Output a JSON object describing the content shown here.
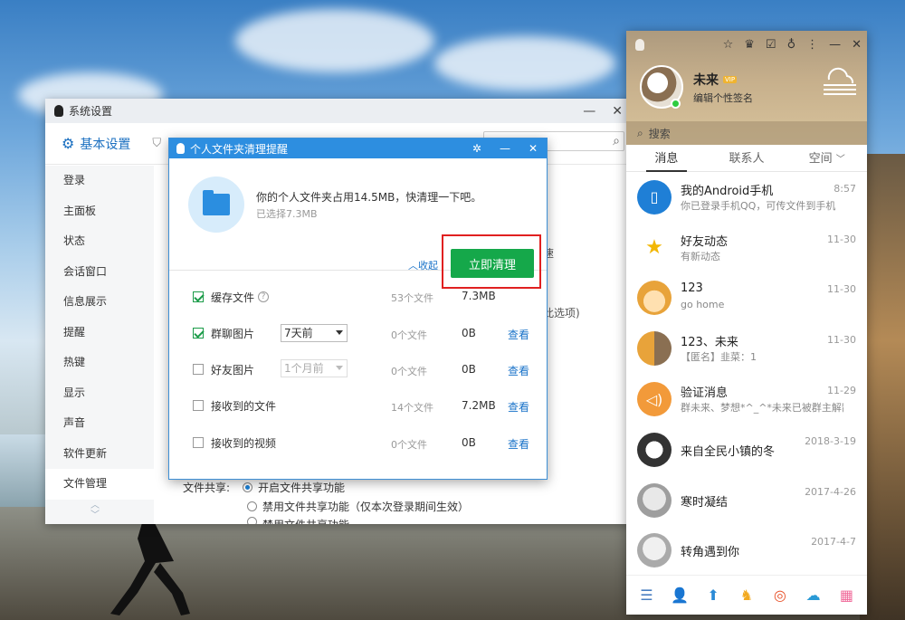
{
  "settings_window": {
    "title": "系统设置",
    "tab_basic": "基本设置",
    "sidebar": [
      {
        "label": "登录"
      },
      {
        "label": "主面板"
      },
      {
        "label": "状态"
      },
      {
        "label": "会话窗口"
      },
      {
        "label": "信息展示"
      },
      {
        "label": "提醒"
      },
      {
        "label": "热键"
      },
      {
        "label": "显示"
      },
      {
        "label": "声音"
      },
      {
        "label": "软件更新"
      },
      {
        "label": "文件管理"
      }
    ],
    "file_share_label": "文件共享:",
    "share_options": [
      "开启文件共享功能",
      "禁用文件共享功能（仅本次登录期间生效）",
      "禁用文件共享功能"
    ],
    "bg_fragment_1": "速",
    "bg_fragment_2": "此选项)"
  },
  "cleanup_popup": {
    "title": "个人文件夹清理提醒",
    "message": "你的个人文件夹占用14.5MB，快清理一下吧。",
    "selected": "已选择7.3MB",
    "collapse": "收起",
    "clean_button": "立即清理",
    "rows": [
      {
        "label": "缓存文件",
        "checked": true,
        "count": "53个文件",
        "size": "7.3MB",
        "view": ""
      },
      {
        "label": "群聊图片",
        "checked": true,
        "dropdown": "7天前",
        "count": "0个文件",
        "size": "0B",
        "view": "查看"
      },
      {
        "label": "好友图片",
        "checked": false,
        "dropdown": "1个月前",
        "count": "0个文件",
        "size": "0B",
        "view": "查看"
      },
      {
        "label": "接收到的文件",
        "checked": false,
        "count": "14个文件",
        "size": "7.2MB",
        "view": "查看"
      },
      {
        "label": "接收到的视频",
        "checked": false,
        "count": "0个文件",
        "size": "0B",
        "view": "查看"
      }
    ]
  },
  "qq_panel": {
    "nickname": "未来",
    "badge": "VIP",
    "signature": "编辑个性签名",
    "search_placeholder": "搜索",
    "tabs": [
      "消息",
      "联系人",
      "空间"
    ],
    "conversations": [
      {
        "name": "我的Android手机",
        "preview": "你已登录手机QQ，可传文件到手机",
        "time": "8:57",
        "avatar_color": "#1f7fd6",
        "icon": "phone-icon"
      },
      {
        "name": "好友动态",
        "preview": "有新动态",
        "time": "11-30",
        "avatar_color": "#ffffff",
        "icon": "qzone-star-icon"
      },
      {
        "name": "123",
        "preview": "go home",
        "time": "11-30",
        "avatar_color": "#f0c27a",
        "icon": "cartoon-avatar"
      },
      {
        "name": "123、未来",
        "preview": "【匿名】韭菜：1",
        "time": "11-30",
        "avatar_color": "#c8a680",
        "icon": "group-avatar"
      },
      {
        "name": "验证消息",
        "preview": "群未来、梦想*^_^*未来已被群主解散",
        "time": "11-29",
        "avatar_color": "#f29a3a",
        "icon": "speaker-icon"
      },
      {
        "name": "来自全民小镇的冬",
        "preview": "",
        "time": "2018-3-19",
        "avatar_color": "#555555",
        "icon": "dog-avatar"
      },
      {
        "name": "寒时凝结",
        "preview": "",
        "time": "2017-4-26",
        "avatar_color": "#bdbdbd",
        "icon": "baby-avatar"
      },
      {
        "name": "转角遇到你",
        "preview": "",
        "time": "2017-4-7",
        "avatar_color": "#cfcfcf",
        "icon": "baby-avatar"
      }
    ]
  }
}
